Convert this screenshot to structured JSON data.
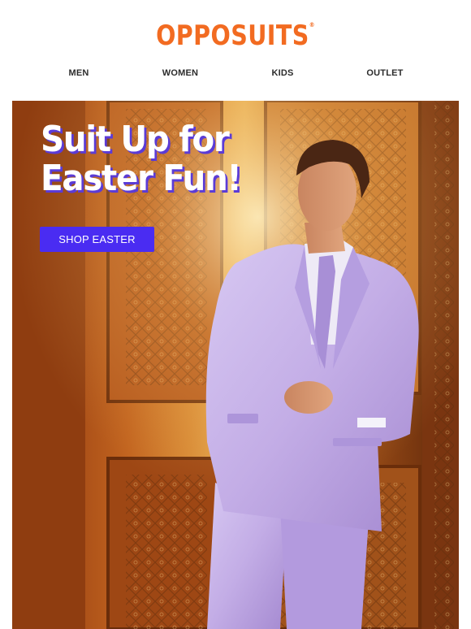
{
  "brand": {
    "logo_text": "OPPOSUITS",
    "logo_mark": "®",
    "color": "#f26b21"
  },
  "nav": {
    "items": [
      {
        "label": "MEN"
      },
      {
        "label": "WOMEN"
      },
      {
        "label": "KIDS"
      },
      {
        "label": "OUTLET"
      }
    ]
  },
  "hero": {
    "headline_line1": "Suit Up for",
    "headline_line2": "Easter Fun!",
    "cta_label": "SHOP EASTER",
    "cta_color": "#4a2cf2",
    "headline_shadow_color": "#5b3bd6",
    "suit_color": "#c6b2e8"
  }
}
